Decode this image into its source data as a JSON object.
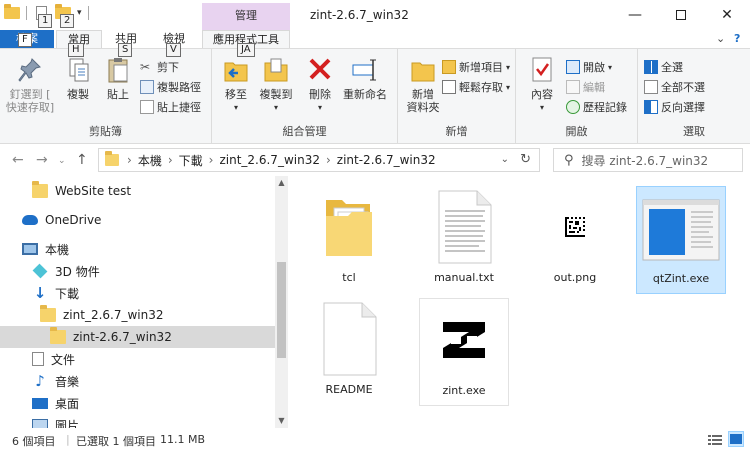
{
  "window": {
    "title": "zint-2.6.7_win32",
    "context_header": "管理",
    "min_icon": "minimize-icon",
    "max_icon": "maximize-icon",
    "close_icon": "close-icon"
  },
  "keytips": {
    "qat1": "1",
    "qat2": "2",
    "file": "F",
    "home": "H",
    "share": "S",
    "view": "V",
    "app_tools": "JA"
  },
  "tabs": {
    "file": "檔案",
    "home": "常用",
    "share": "共用",
    "view": "檢視",
    "app_tools": "應用程式工具"
  },
  "ribbon": {
    "clipboard": {
      "label": "剪貼簿",
      "pin": "釘選到 [",
      "pin2": "快速存取]",
      "copy": "複製",
      "paste": "貼上",
      "cut": "剪下",
      "copy_path": "複製路徑",
      "paste_shortcut": "貼上捷徑"
    },
    "organize": {
      "label": "組合管理",
      "move_to": "移至",
      "copy_to": "複製到",
      "delete": "刪除",
      "rename": "重新命名"
    },
    "new": {
      "label": "新增",
      "new_folder": "新增",
      "new_folder2": "資料夾",
      "new_item": "新增項目",
      "easy_access": "輕鬆存取"
    },
    "open": {
      "label": "開啟",
      "properties": "內容",
      "open": "開啟",
      "edit": "編輯",
      "history": "歷程記錄"
    },
    "select": {
      "label": "選取",
      "select_all": "全選",
      "select_none": "全部不選",
      "invert": "反向選擇"
    }
  },
  "address": {
    "crumbs": [
      "本機",
      "下載",
      "zint_2.6.7_win32",
      "zint-2.6.7_win32"
    ],
    "search_placeholder": "搜尋 zint-2.6.7_win32"
  },
  "nav": {
    "items": [
      {
        "label": "WebSite test",
        "icon": "folder-icon"
      },
      {
        "label": "OneDrive",
        "icon": "onedrive-icon"
      },
      {
        "label": "本機",
        "icon": "computer-icon"
      },
      {
        "label": "3D 物件",
        "icon": "3d-objects-icon"
      },
      {
        "label": "下載",
        "icon": "downloads-icon"
      },
      {
        "label": "zint_2.6.7_win32",
        "icon": "folder-icon"
      },
      {
        "label": "zint-2.6.7_win32",
        "icon": "folder-icon"
      },
      {
        "label": "文件",
        "icon": "documents-icon"
      },
      {
        "label": "音樂",
        "icon": "music-icon"
      },
      {
        "label": "桌面",
        "icon": "desktop-icon"
      },
      {
        "label": "圖片",
        "icon": "pictures-icon"
      }
    ]
  },
  "files": [
    {
      "name": "tcl",
      "icon": "folder-icon"
    },
    {
      "name": "manual.txt",
      "icon": "text-file-icon"
    },
    {
      "name": "out.png",
      "icon": "datamatrix-image-icon"
    },
    {
      "name": "qtZint.exe",
      "icon": "app-window-icon"
    },
    {
      "name": "README",
      "icon": "blank-file-icon"
    },
    {
      "name": "zint.exe",
      "icon": "zint-logo-icon"
    }
  ],
  "status": {
    "count": "6 個項目",
    "selected": "已選取 1 個項目",
    "size": "11.1 MB"
  },
  "colors": {
    "accent": "#1e6fc7",
    "context_tab": "#e8d3f0",
    "selection": "#cce8ff"
  }
}
